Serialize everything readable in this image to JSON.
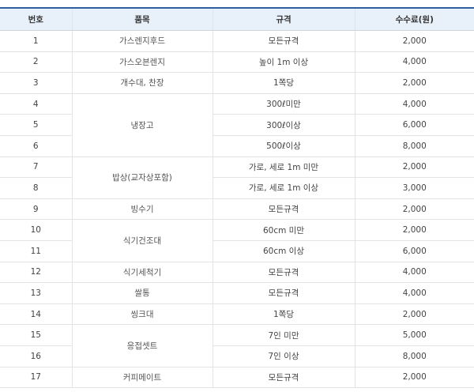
{
  "headers": [
    "번호",
    "품목",
    "규격",
    "수수료(원)"
  ],
  "rows": [
    {
      "no": "1",
      "item": "가스렌지후드",
      "spec": "모든규격",
      "fee": "2,000"
    },
    {
      "no": "2",
      "item": "가스오븐렌지",
      "spec": "높이 1m 이상",
      "fee": "4,000"
    },
    {
      "no": "3",
      "item": "개수대, 찬장",
      "spec": "1쪽당",
      "fee": "2,000"
    },
    {
      "no": "4",
      "item": "냉장고",
      "spec": "300ℓ미만",
      "fee": "4,000"
    },
    {
      "no": "5",
      "item": "",
      "spec": "300ℓ이상",
      "fee": "6,000"
    },
    {
      "no": "6",
      "item": "",
      "spec": "500ℓ이상",
      "fee": "8,000"
    },
    {
      "no": "7",
      "item": "밥상(교자상포함)",
      "spec": "가로, 세로 1m 미만",
      "fee": "2,000"
    },
    {
      "no": "8",
      "item": "",
      "spec": "가로, 세로 1m 이상",
      "fee": "3,000"
    },
    {
      "no": "9",
      "item": "빙수기",
      "spec": "모든규격",
      "fee": "2,000"
    },
    {
      "no": "10",
      "item": "식기건조대",
      "spec": "60cm 미만",
      "fee": "2,000"
    },
    {
      "no": "11",
      "item": "",
      "spec": "60cm 이상",
      "fee": "6,000"
    },
    {
      "no": "12",
      "item": "식기세척기",
      "spec": "모든규격",
      "fee": "4,000"
    },
    {
      "no": "13",
      "item": "쌀통",
      "spec": "모든규격",
      "fee": "4,000"
    },
    {
      "no": "14",
      "item": "씽크대",
      "spec": "1쪽당",
      "fee": "2,000"
    },
    {
      "no": "15",
      "item": "응접셋트",
      "spec": "7인 미만",
      "fee": "5,000"
    },
    {
      "no": "16",
      "item": "",
      "spec": "7인 이상",
      "fee": "8,000"
    },
    {
      "no": "17",
      "item": "커피메이트",
      "spec": "모든규격",
      "fee": "2,000"
    }
  ]
}
